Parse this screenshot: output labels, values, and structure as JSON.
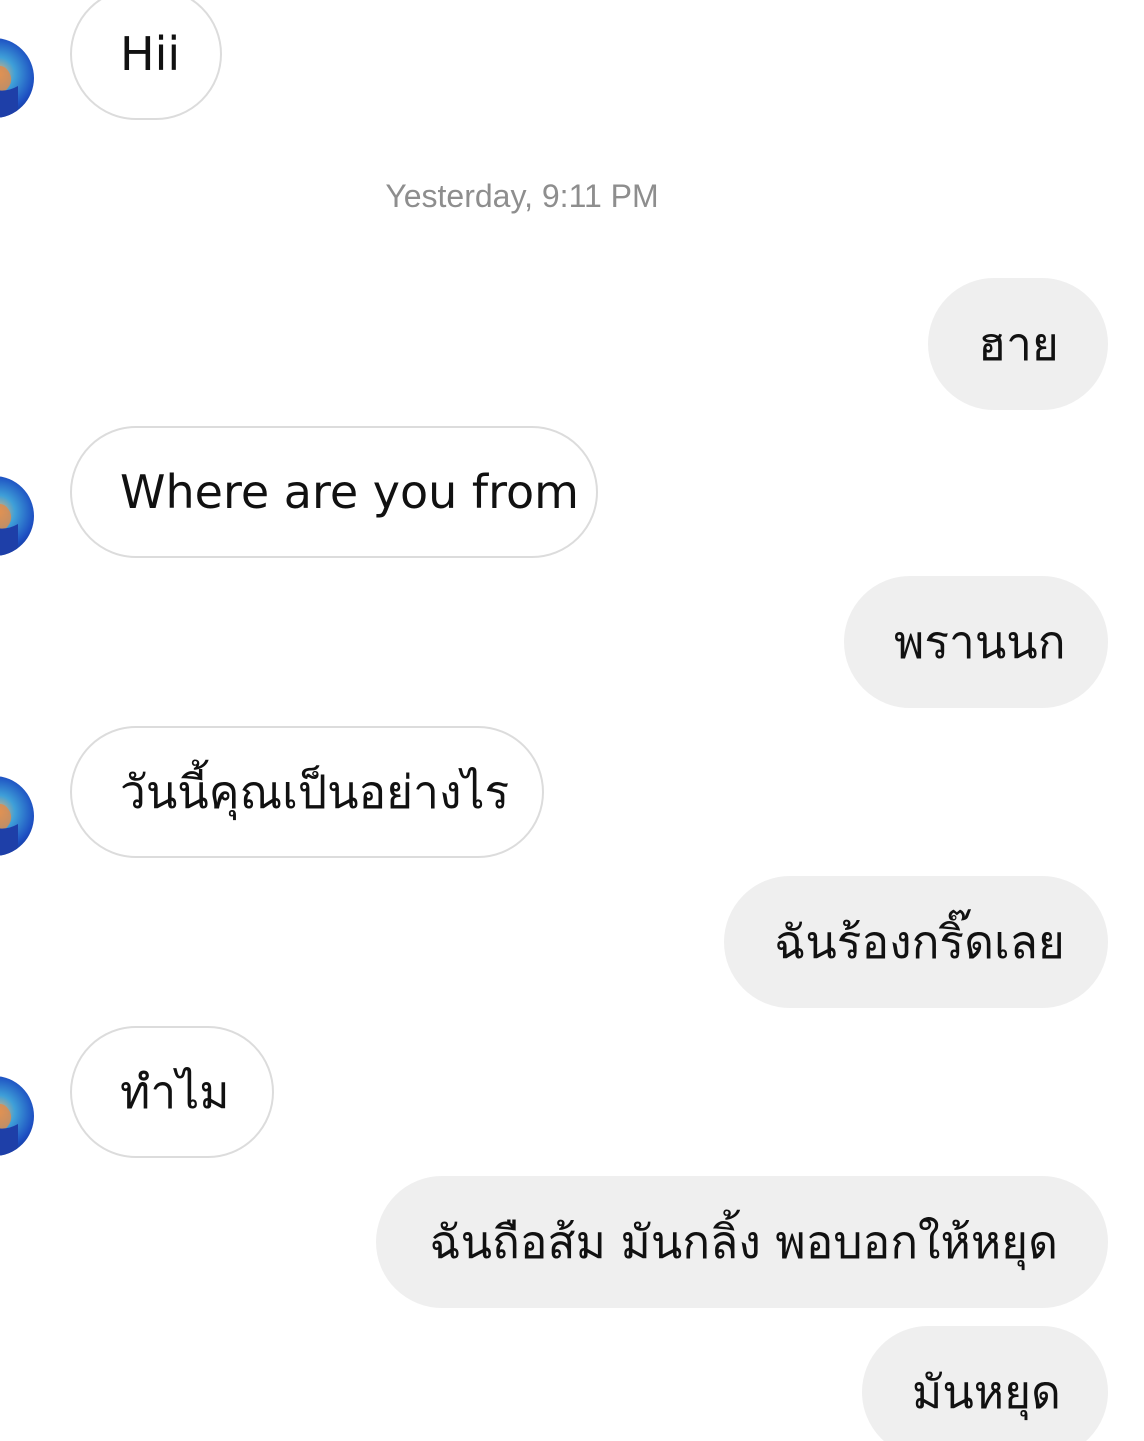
{
  "conversation": {
    "timestamp": "Yesterday, 9:11 PM",
    "messages": [
      {
        "sender": "them",
        "text": "Hii"
      },
      {
        "sender": "me",
        "text": "ฮาย"
      },
      {
        "sender": "them",
        "text": "Where are you from"
      },
      {
        "sender": "me",
        "text": "พรานนก"
      },
      {
        "sender": "them",
        "text": "วันนี้คุณเป็นอย่างไร"
      },
      {
        "sender": "me",
        "text": "ฉันร้องกริ๊ดเลย"
      },
      {
        "sender": "them",
        "text": "ทำไม"
      },
      {
        "sender": "me",
        "text": "ฉันถือส้ม มันกลิ้ง พอบอกให้หยุด"
      },
      {
        "sender": "me",
        "text": "มันหยุด"
      }
    ]
  },
  "colors": {
    "incoming_bubble": "#ffffff",
    "incoming_border": "#dcdcdc",
    "outgoing_bubble": "#efefef",
    "timestamp_text": "#8e8e8e",
    "message_text": "#111111"
  },
  "icons": {
    "avatar": "profile-avatar-icon"
  }
}
